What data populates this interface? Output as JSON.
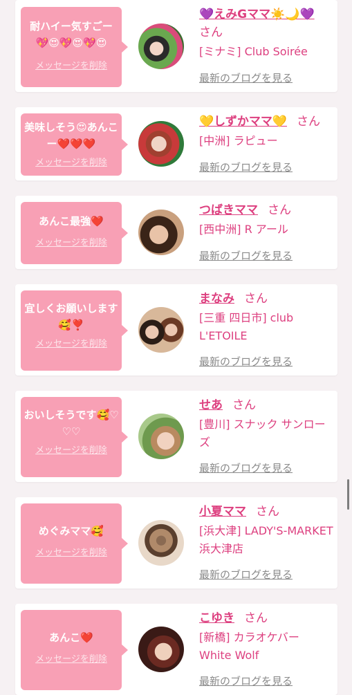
{
  "delete_label": "メッセージを削除",
  "blog_label": "最新のブログを見る",
  "suffix": "さん",
  "items": [
    {
      "message": "耐ハイー気すごー💖😍💖😍💖😍",
      "name": "💜えみGママ☀️🌙💜",
      "shop": "[ミナミ] Club Soirée"
    },
    {
      "message": "美味しそう😍あんこー❤️❤️❤️",
      "name": "💛しずかママ💛",
      "shop": "[中洲] ラピュー"
    },
    {
      "message": "あんこ最強❤️",
      "name": "つばきママ",
      "shop": "[西中洲] R アール"
    },
    {
      "message": "宜しくお願いします🥰❣️",
      "name": "まなみ",
      "shop": "[三重 四日市] club L'ETOILE"
    },
    {
      "message": "おいしそうです🥰♡♡♡",
      "name": "せあ",
      "shop": "[豊川] スナック サンローズ"
    },
    {
      "message": "めぐみママ🥰",
      "name": "小夏ママ",
      "shop": "[浜大津] LADY'S-MARKET 浜大津店"
    },
    {
      "message": "あんこ❤️",
      "name": "こゆき",
      "shop": "[新橋] カラオケバー White Wolf"
    }
  ]
}
